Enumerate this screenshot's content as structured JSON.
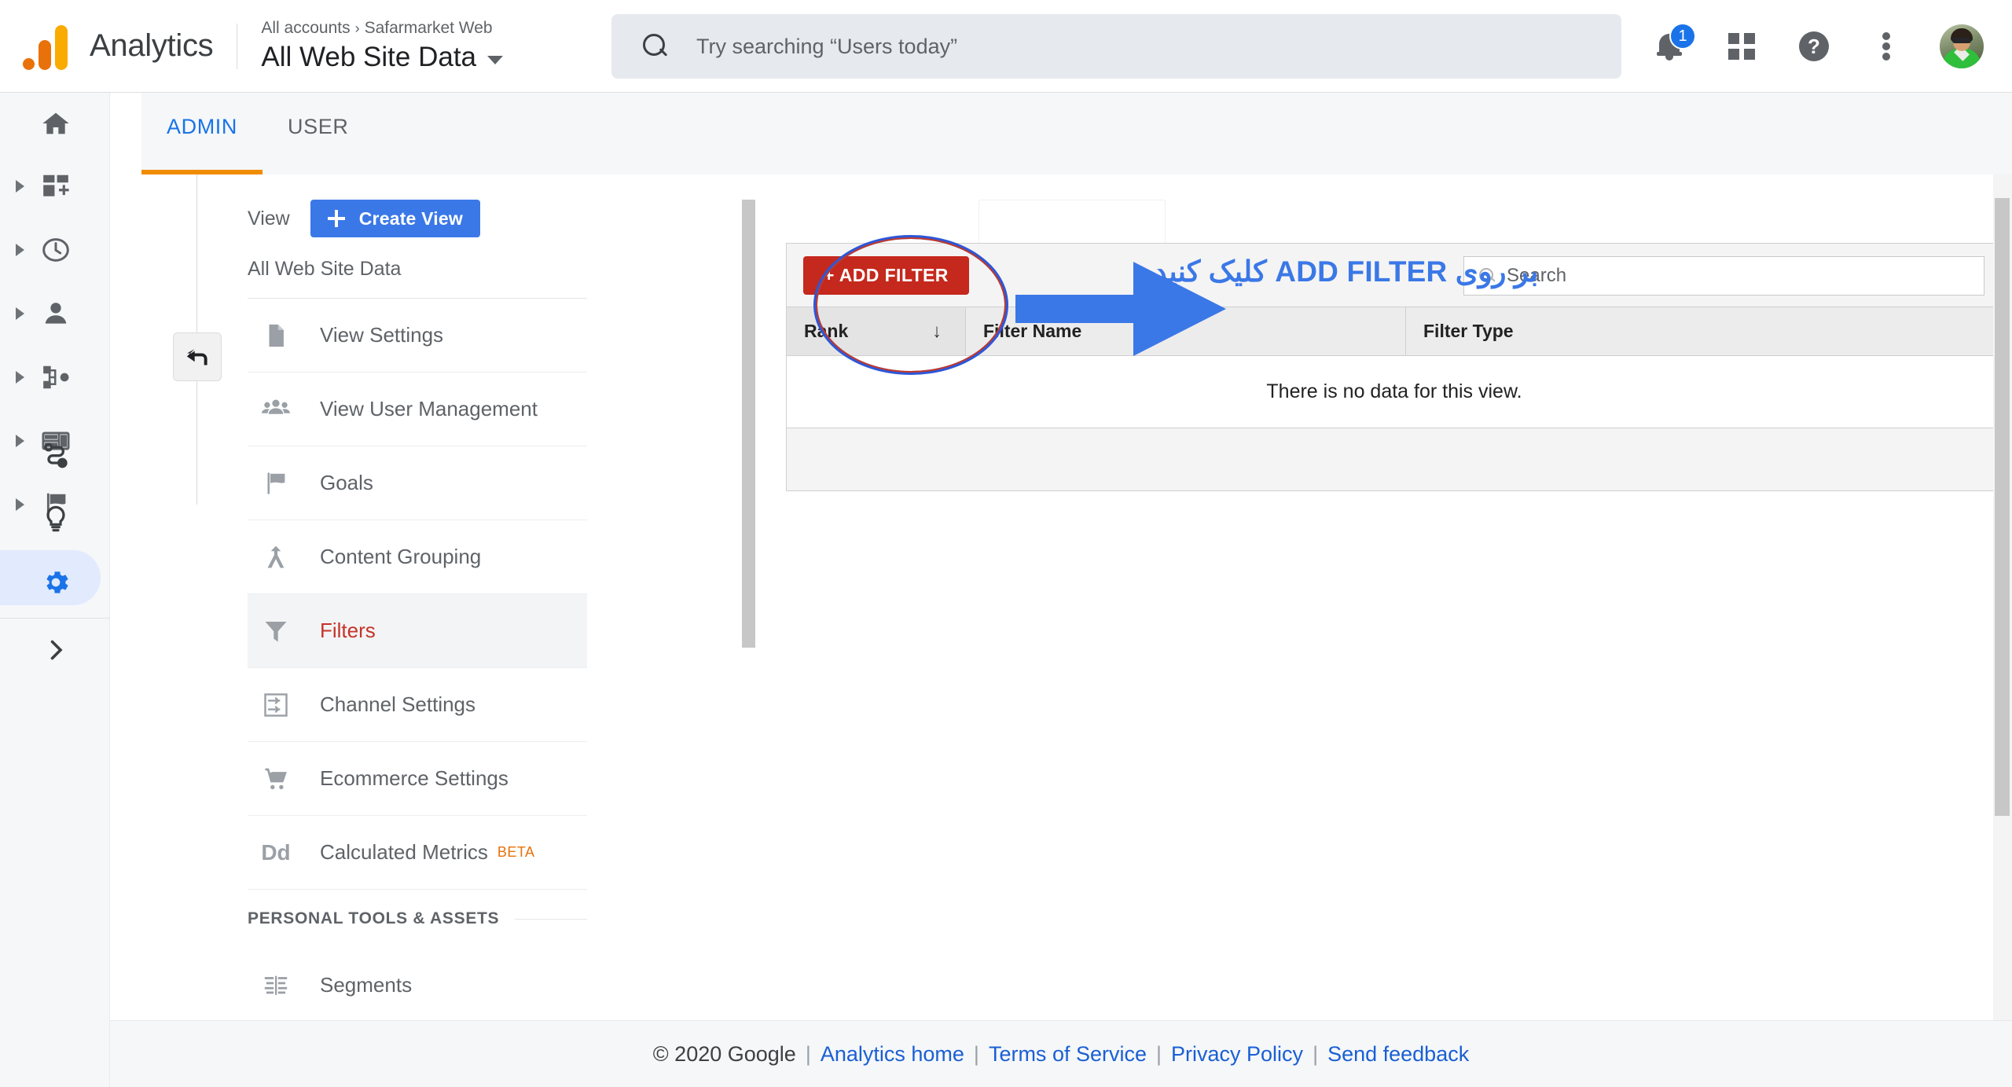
{
  "topbar": {
    "brand": "Analytics",
    "breadcrumb_root": "All accounts",
    "breadcrumb_sep": "›",
    "breadcrumb_account": "Safarmarket Web",
    "view_title": "All Web Site Data",
    "search_placeholder": "Try searching “Users today”",
    "notification_count": "1",
    "help_glyph": "?",
    "icons": {
      "search": "search-icon",
      "bell": "notifications-bell-icon",
      "apps": "apps-grid-icon",
      "help": "help-circle-icon",
      "more": "more-vert-icon",
      "avatar": "user-avatar"
    }
  },
  "rail": {
    "items": [
      {
        "name": "home",
        "icon": "home-icon",
        "has_arrow": false,
        "selected": false
      },
      {
        "name": "customization",
        "icon": "customization-icon",
        "has_arrow": true,
        "selected": false
      },
      {
        "name": "realtime",
        "icon": "clock-icon",
        "has_arrow": true,
        "selected": false
      },
      {
        "name": "audience",
        "icon": "person-icon",
        "has_arrow": true,
        "selected": false
      },
      {
        "name": "acquisition",
        "icon": "share-nodes-icon",
        "has_arrow": true,
        "selected": false
      },
      {
        "name": "behavior",
        "icon": "layout-panels-icon",
        "has_arrow": true,
        "selected": false
      },
      {
        "name": "conversions",
        "icon": "flag-icon",
        "has_arrow": true,
        "selected": false
      }
    ],
    "bottom_items": [
      {
        "name": "discover",
        "icon": "path-nodes-icon",
        "selected": false
      },
      {
        "name": "attribution",
        "icon": "lightbulb-icon",
        "selected": false
      },
      {
        "name": "admin",
        "icon": "gear-icon",
        "selected": true
      }
    ],
    "expand": {
      "name": "expand-rail",
      "icon": "chevron-right-icon"
    }
  },
  "tabs": [
    {
      "label": "ADMIN",
      "active": true
    },
    {
      "label": "USER",
      "active": false
    }
  ],
  "view_panel": {
    "column_label": "View",
    "create_button": "Create View",
    "current_view": "All Web Site Data",
    "items": [
      {
        "label": "View Settings",
        "icon": "document-icon",
        "selected": false
      },
      {
        "label": "View User Management",
        "icon": "group-people-icon",
        "selected": false
      },
      {
        "label": "Goals",
        "icon": "flag-icon",
        "selected": false
      },
      {
        "label": "Content Grouping",
        "icon": "content-grouping-icon",
        "selected": false
      },
      {
        "label": "Filters",
        "icon": "funnel-filter-icon",
        "selected": true
      },
      {
        "label": "Channel Settings",
        "icon": "channel-settings-icon",
        "selected": false
      },
      {
        "label": "Ecommerce Settings",
        "icon": "shopping-cart-icon",
        "selected": false
      },
      {
        "label": "Calculated Metrics",
        "icon": "dd-metrics-icon",
        "selected": false,
        "badge": "BETA"
      }
    ],
    "section_title": "PERSONAL TOOLS & ASSETS",
    "section_items": [
      {
        "label": "Segments",
        "icon": "segments-icon",
        "selected": false
      }
    ],
    "collapse_button": {
      "name": "collapse-panel-button",
      "icon": "arrow-left-icon"
    }
  },
  "filters": {
    "add_button": "+ ADD FILTER",
    "search_placeholder": "Search",
    "search_value": "",
    "columns": [
      "Rank",
      "Filter Name",
      "Filter Type"
    ],
    "sort_column": "Rank",
    "sort_glyph": "↓",
    "rows": [],
    "empty_message": "There is no data for this view."
  },
  "annotation": {
    "text": "بر روی ADD FILTER کلیک کنید",
    "arrow": "right-arrow-annotation",
    "circle": "highlight-ellipse-annotation",
    "color": "#3b78e7",
    "circle_color": "#2d57d8"
  },
  "footer": {
    "copyright": "© 2020 Google",
    "links": [
      "Analytics home",
      "Terms of Service",
      "Privacy Policy",
      "Send feedback"
    ],
    "separator": "|"
  },
  "colors": {
    "brand_orange": "#e8710a",
    "brand_yellow": "#f9ab00",
    "accent_blue": "#1a73e8",
    "danger_red": "#c5281c",
    "tab_underline": "#f08c00"
  }
}
